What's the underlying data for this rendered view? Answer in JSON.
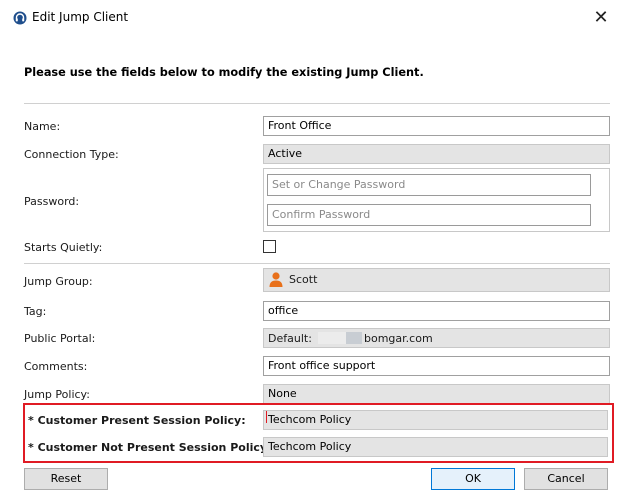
{
  "window": {
    "title": "Edit Jump Client"
  },
  "heading": "Please use the fields below to modify the existing Jump Client.",
  "fields": {
    "name": {
      "label": "Name:",
      "value": "Front Office"
    },
    "connection_type": {
      "label": "Connection Type:",
      "value": "Active"
    },
    "password": {
      "label": "Password:",
      "placeholder": "Set or Change Password",
      "confirm_placeholder": "Confirm Password"
    },
    "starts_quietly": {
      "label": "Starts Quietly:",
      "checked": false
    },
    "jump_group": {
      "label": "Jump Group:",
      "value": "Scott",
      "icon": "user-avatar-icon"
    },
    "tag": {
      "label": "Tag:",
      "value": "office"
    },
    "public_portal": {
      "label": "Public Portal:",
      "prefix": "Default:",
      "value": "bomgar.com"
    },
    "comments": {
      "label": "Comments:",
      "value": "Front office support"
    },
    "jump_policy": {
      "label": "Jump Policy:",
      "value": "None"
    },
    "customer_present_policy": {
      "label": "* Customer Present Session Policy:",
      "value": "Techcom Policy"
    },
    "customer_not_present_policy": {
      "label": "* Customer Not Present Session Policy:",
      "value": "Techcom Policy"
    }
  },
  "buttons": {
    "reset": "Reset",
    "ok": "OK",
    "cancel": "Cancel"
  },
  "colors": {
    "highlight": "#e01b24",
    "readonly_bg": "#e4e4e4",
    "ok_border": "#0078d7",
    "avatar": "#e8701a"
  }
}
